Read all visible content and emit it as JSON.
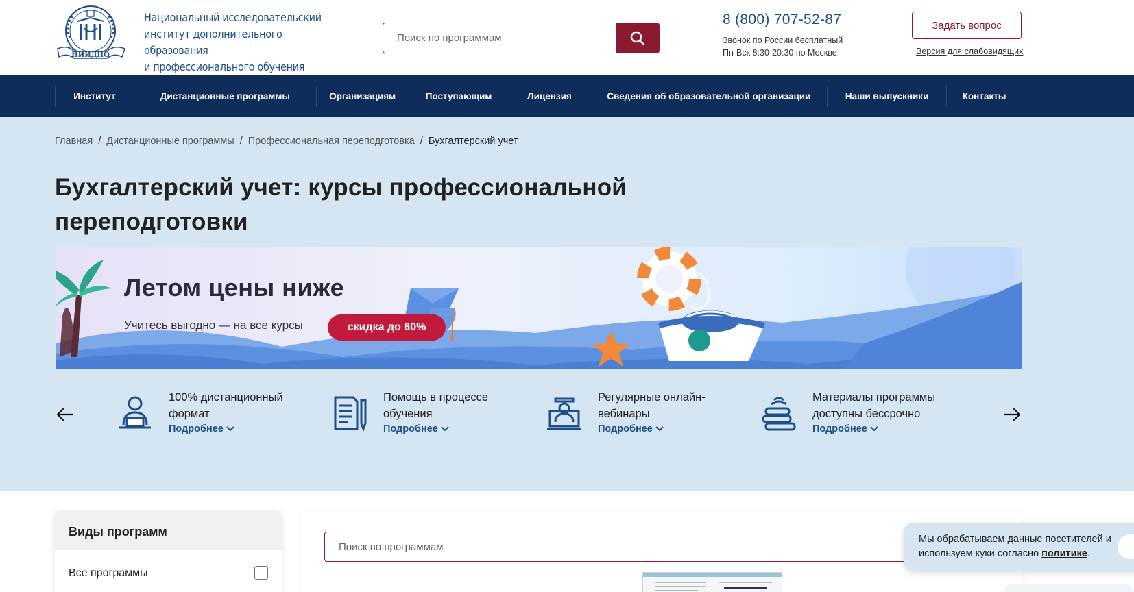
{
  "header": {
    "logo_text_lines": [
      "Национальный исследовательский",
      "институт дополнительного образования",
      "и профессионального обучения"
    ],
    "logo_caption": "НИИДПО",
    "search_placeholder": "Поиск по программам",
    "phone": "8 (800) 707-52-87",
    "phone_note_1": "Звонок по России бесплатный",
    "phone_note_2": "Пн-Вск 8:30-20:30 по Москве",
    "ask_button": "Задать вопрос",
    "vision_link": "Версия для слабовидящих"
  },
  "nav": {
    "items": [
      "Институт",
      "Дистанционные программы",
      "Организациям",
      "Поступающим",
      "Лицензия",
      "Сведения об образовательной организации",
      "Наши выпускники",
      "Контакты"
    ]
  },
  "breadcrumbs": {
    "items": [
      "Главная",
      "Дистанционные программы",
      "Профессиональная переподготовка"
    ],
    "current": "Бухгалтерский учет"
  },
  "page": {
    "title": "Бухгалтерский учет: курсы профессиональной переподготовки"
  },
  "banner": {
    "title": "Летом цены ниже",
    "subtitle": "Учитесь выгодно — на все курсы",
    "badge": "скидка до 60%"
  },
  "features": {
    "more_label": "Подробнее",
    "items": [
      {
        "text": "100% дистанционный формат",
        "icon": "remote-learner-icon"
      },
      {
        "text": "Помощь в процессе обучения",
        "icon": "document-pen-icon"
      },
      {
        "text": "Регулярные онлайн-вебинары",
        "icon": "webinar-teacher-icon"
      },
      {
        "text": "Материалы программы доступны бессрочно",
        "icon": "books-stack-icon"
      }
    ]
  },
  "sidebar": {
    "heading": "Виды программ",
    "all_programs": "Все программы"
  },
  "main": {
    "search_placeholder": "Поиск по программам"
  },
  "cookie": {
    "text_before": "Мы обрабатываем данные посетителей и используем куки согласно ",
    "link": "политике",
    "text_after": "."
  },
  "colors": {
    "brand_red": "#8b1a2e",
    "nav_blue": "#0f2d5a",
    "link_blue": "#1d4f8a",
    "hero_bg": "#d5e6f2",
    "badge_red": "#c21a3d"
  }
}
